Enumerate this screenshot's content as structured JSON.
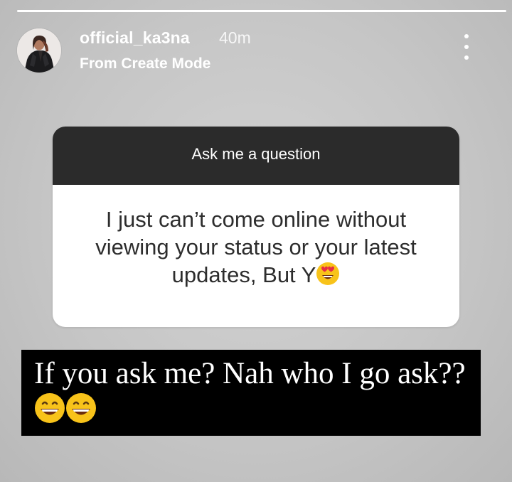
{
  "story": {
    "progress_segments": 1,
    "username": "official_ka3na",
    "time": "40m",
    "subtitle": "From Create Mode",
    "avatar_icon": "profile-photo-icon",
    "more_icon": "more-options-icon"
  },
  "question_sticker": {
    "title": "Ask me a question",
    "text": "I just can’t come online without viewing your status or your latest updates, But Y",
    "emoji": "heart-eyes-emoji"
  },
  "reply": {
    "text": "If you ask me? Nah who I go ask??",
    "emojis": [
      "grinning-face-emoji",
      "grinning-face-emoji"
    ]
  },
  "colors": {
    "background": "#c8c8c8",
    "card_header": "#2b2b2b",
    "card_body": "#ffffff",
    "reply_background": "#000000",
    "emoji_yellow": "#f8c31a"
  }
}
